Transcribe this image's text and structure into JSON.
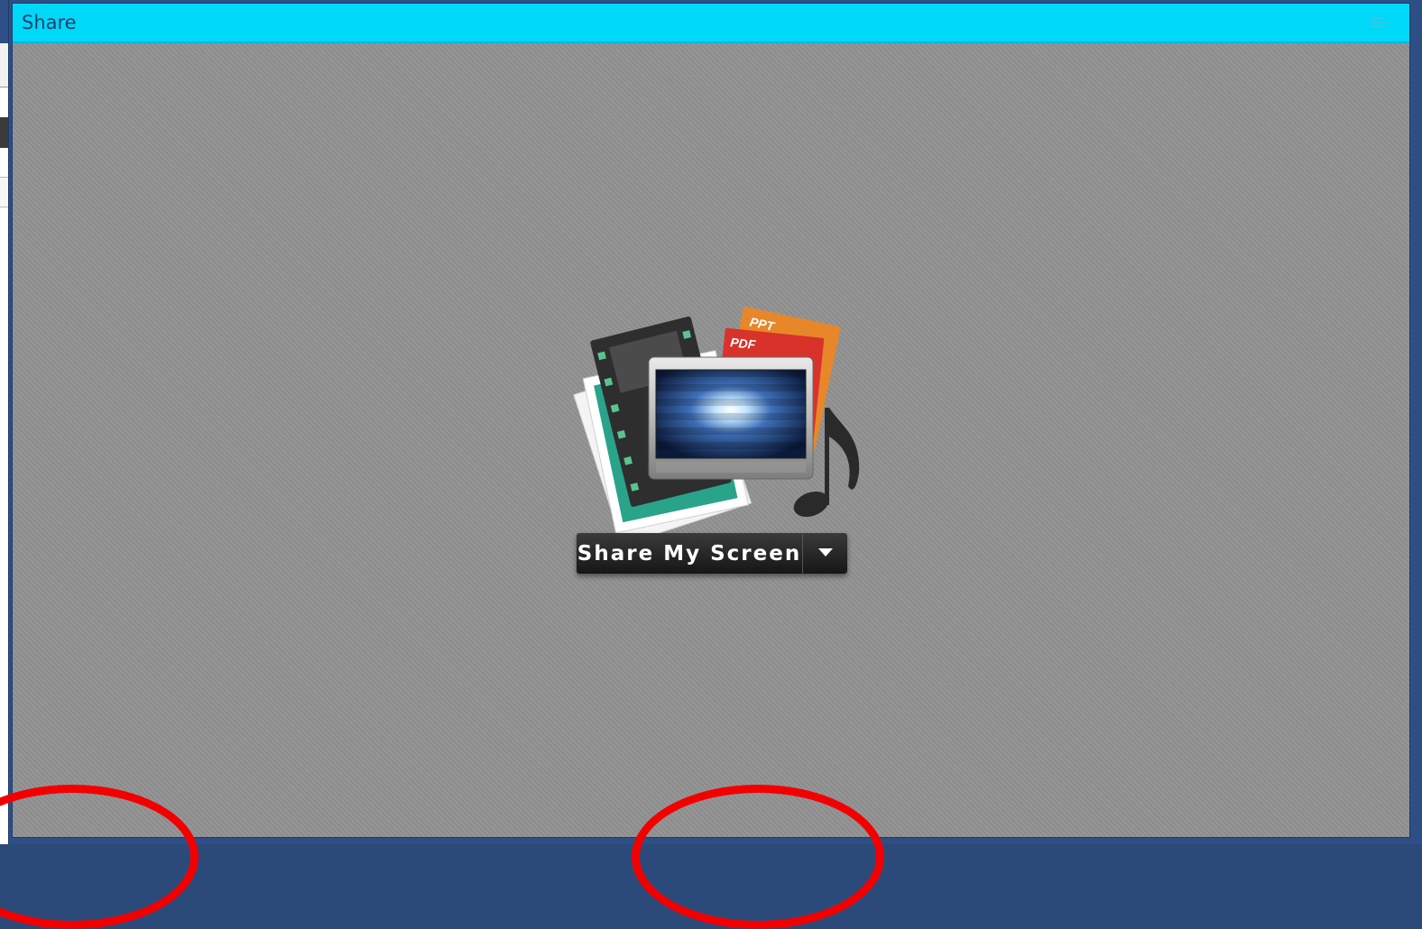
{
  "window": {
    "title": "Share"
  },
  "share": {
    "button_label": "Share My Screen",
    "doc_labels": {
      "ppt": "PPT",
      "pdf": "PDF"
    }
  },
  "colors": {
    "titlebar": "#00d8f8",
    "title_text": "#1f3e6c",
    "pod_bg": "#8f8f8f",
    "annotation": "#f20000"
  },
  "icons": {
    "menu": "hamburger-menu-icon",
    "share_graphic": "share-media-illustration-icon",
    "dropdown": "chevron-down-icon"
  }
}
